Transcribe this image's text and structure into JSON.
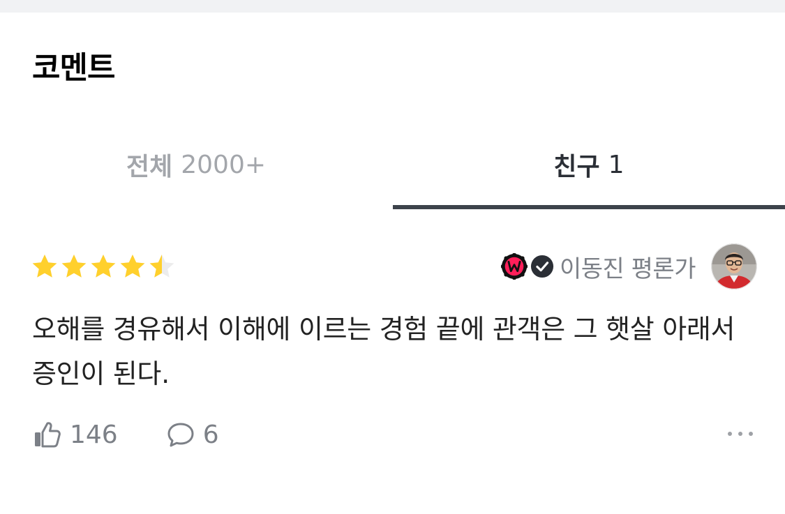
{
  "header": {
    "title": "코멘트"
  },
  "tabs": [
    {
      "label": "전체",
      "count": "2000+",
      "selected": false
    },
    {
      "label": "친구",
      "count": "1",
      "selected": true
    }
  ],
  "comment": {
    "rating": 4.5,
    "rating_max": 5,
    "author": {
      "name": "이동진 평론가",
      "badges": [
        "w-badge-icon",
        "verified-check-icon"
      ],
      "avatar": "avatar"
    },
    "text": "오해를 경유해서 이해에 이르는 경험 끝에 관객은 그 햇살 아래서 증인이 된다.",
    "likes": "146",
    "replies": "6"
  },
  "icons": {
    "like": "thumbs-up-icon",
    "reply": "speech-bubble-icon",
    "more": "more-dots-icon"
  },
  "colors": {
    "star_filled": "#ffd02c",
    "star_empty": "#ececec",
    "tab_underline": "#3d434b",
    "badge_w": "#ff1f5a"
  }
}
